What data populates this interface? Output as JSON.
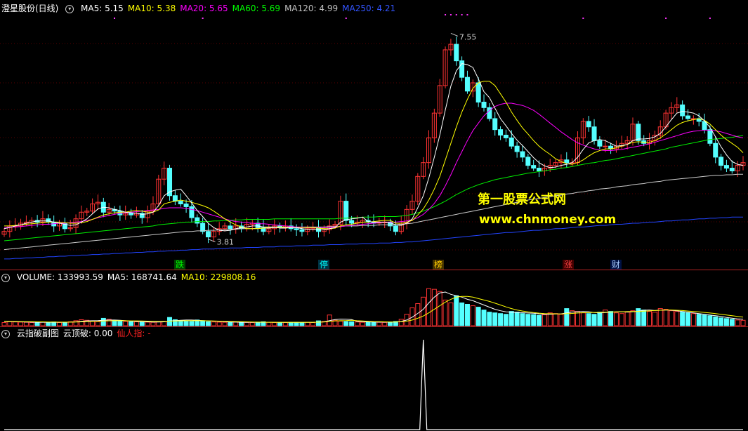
{
  "main": {
    "title": "澄星股份(日线)",
    "ma_labels": [
      {
        "text": "MA5: 5.15",
        "color": "#ffffff"
      },
      {
        "text": "MA10: 5.38",
        "color": "#ffff00"
      },
      {
        "text": "MA20: 5.65",
        "color": "#ff00ff"
      },
      {
        "text": "MA60: 5.69",
        "color": "#00ff00"
      },
      {
        "text": "MA120: 4.99",
        "color": "#c0c0c0"
      },
      {
        "text": "MA250: 4.21",
        "color": "#3355ff"
      }
    ],
    "high_label": "7.55",
    "low_label": "3.81",
    "events": [
      {
        "text": "跌",
        "color": "#00ff00",
        "bg": "#004400"
      },
      {
        "text": "停",
        "color": "#00ffff",
        "bg": "#003344"
      },
      {
        "text": "榜",
        "color": "#ffcc00",
        "bg": "#443300"
      },
      {
        "text": "涨",
        "color": "#ff4444",
        "bg": "#440000"
      },
      {
        "text": "财",
        "color": "#aaccff",
        "bg": "#001144"
      }
    ],
    "watermark_cn": "第一股票公式网",
    "watermark_url": "www.chnmoney.com"
  },
  "volume": {
    "labels": [
      {
        "text": "VOLUME: 133993.59",
        "color": "#ffffff"
      },
      {
        "text": "MA5: 168741.64",
        "color": "#ffffff"
      },
      {
        "text": "MA10: 229808.16",
        "color": "#ffff00"
      }
    ]
  },
  "indicator": {
    "labels": [
      {
        "text": "云指破副图",
        "color": "#ffffff"
      },
      {
        "text": "云顶破: 0.00",
        "color": "#ffffff"
      },
      {
        "text": "仙人指: -",
        "color": "#ff2222"
      }
    ]
  },
  "chart_data": {
    "type": "candlestick",
    "y_range": [
      3.5,
      7.9
    ],
    "close": [
      3.95,
      4.05,
      4.05,
      4.1,
      4.12,
      4.15,
      4.12,
      4.18,
      4.12,
      4.05,
      4.1,
      4.0,
      4.02,
      4.18,
      4.3,
      4.32,
      4.45,
      4.48,
      4.3,
      4.35,
      4.32,
      4.25,
      4.28,
      4.25,
      4.28,
      4.2,
      4.32,
      4.45,
      4.9,
      5.1,
      4.6,
      4.5,
      4.45,
      4.4,
      4.2,
      4.1,
      3.95,
      3.85,
      3.95,
      4.0,
      4.05,
      4.0,
      4.05,
      4.0,
      4.08,
      4.1,
      4.02,
      3.95,
      4.0,
      4.05,
      4.02,
      4.05,
      4.0,
      3.98,
      3.95,
      4.0,
      4.02,
      3.95,
      3.98,
      4.05,
      4.08,
      4.5,
      4.15,
      4.1,
      4.12,
      4.15,
      4.12,
      4.1,
      4.12,
      4.12,
      4.05,
      3.95,
      4.1,
      4.35,
      4.5,
      4.95,
      5.2,
      5.65,
      6.1,
      6.6,
      7.25,
      7.35,
      7.05,
      6.75,
      6.5,
      6.65,
      6.3,
      6.2,
      6.0,
      5.8,
      5.7,
      5.65,
      5.5,
      5.4,
      5.3,
      5.15,
      5.1,
      5.05,
      5.1,
      5.15,
      5.2,
      5.25,
      5.2,
      5.2,
      5.65,
      5.95,
      5.85,
      5.6,
      5.5,
      5.5,
      5.45,
      5.5,
      5.55,
      5.6,
      5.9,
      5.6,
      5.55,
      5.6,
      5.7,
      5.85,
      6.1,
      6.2,
      6.25,
      6.05,
      6.0,
      6.0,
      5.95,
      5.8,
      5.55,
      5.3,
      5.15,
      5.1,
      5.05,
      5.15,
      5.2
    ],
    "ma5": [
      4.0,
      4.02,
      4.05,
      4.07,
      4.1,
      4.12,
      4.14,
      4.14,
      4.14,
      4.12,
      4.1,
      4.08,
      4.06,
      4.07,
      4.12,
      4.18,
      4.27,
      4.36,
      4.39,
      4.38,
      4.35,
      4.33,
      4.3,
      4.29,
      4.28,
      4.26,
      4.27,
      4.3,
      4.42,
      4.6,
      4.67,
      4.7,
      4.72,
      4.6,
      4.47,
      4.33,
      4.22,
      4.1,
      4.02,
      3.97,
      3.96,
      3.97,
      4.0,
      4.02,
      4.03,
      4.05,
      4.05,
      4.03,
      4.03,
      4.03,
      4.01,
      4.01,
      4.02,
      4.02,
      4.0,
      3.99,
      3.99,
      3.98,
      3.98,
      4.0,
      4.02,
      4.12,
      4.16,
      4.18,
      4.19,
      4.21,
      4.13,
      4.12,
      4.12,
      4.12,
      4.11,
      4.07,
      4.06,
      4.1,
      4.18,
      4.38,
      4.6,
      4.92,
      5.3,
      5.7,
      6.16,
      6.59,
      6.87,
      7.0,
      6.98,
      6.93,
      6.72,
      6.49,
      6.38,
      6.19,
      6.0,
      5.87,
      5.73,
      5.61,
      5.51,
      5.4,
      5.29,
      5.2,
      5.14,
      5.11,
      5.12,
      5.15,
      5.17,
      5.2,
      5.3,
      5.44,
      5.56,
      5.6,
      5.62,
      5.6,
      5.55,
      5.5,
      5.51,
      5.53,
      5.6,
      5.63,
      5.63,
      5.64,
      5.67,
      5.73,
      5.85,
      5.98,
      6.1,
      6.13,
      6.12,
      6.1,
      6.05,
      5.96,
      5.84,
      5.67,
      5.49,
      5.34,
      5.22,
      5.17,
      5.15
    ],
    "ma10": [
      4.05,
      4.05,
      4.06,
      4.07,
      4.08,
      4.09,
      4.1,
      4.11,
      4.12,
      4.12,
      4.12,
      4.11,
      4.1,
      4.1,
      4.11,
      4.13,
      4.17,
      4.21,
      4.25,
      4.27,
      4.29,
      4.3,
      4.3,
      4.32,
      4.33,
      4.32,
      4.3,
      4.3,
      4.34,
      4.45,
      4.48,
      4.5,
      4.52,
      4.5,
      4.48,
      4.45,
      4.42,
      4.38,
      4.32,
      4.25,
      4.18,
      4.12,
      4.07,
      4.03,
      4.0,
      4.0,
      4.0,
      4.01,
      4.02,
      4.03,
      4.03,
      4.03,
      4.02,
      4.02,
      4.02,
      4.02,
      4.02,
      4.01,
      4.0,
      4.0,
      4.01,
      4.05,
      4.07,
      4.08,
      4.1,
      4.12,
      4.12,
      4.13,
      4.14,
      4.15,
      4.15,
      4.1,
      4.1,
      4.12,
      4.15,
      4.25,
      4.36,
      4.52,
      4.72,
      4.95,
      5.25,
      5.55,
      5.85,
      6.12,
      6.35,
      6.55,
      6.65,
      6.68,
      6.68,
      6.6,
      6.45,
      6.3,
      6.12,
      5.97,
      5.83,
      5.72,
      5.6,
      5.5,
      5.42,
      5.35,
      5.27,
      5.22,
      5.18,
      5.17,
      5.2,
      5.25,
      5.32,
      5.38,
      5.42,
      5.45,
      5.45,
      5.47,
      5.5,
      5.53,
      5.57,
      5.58,
      5.57,
      5.57,
      5.6,
      5.65,
      5.72,
      5.8,
      5.88,
      5.93,
      5.96,
      5.98,
      6.0,
      5.97,
      5.9,
      5.8,
      5.7,
      5.62,
      5.55,
      5.48,
      5.38
    ],
    "ma20": [
      4.02,
      4.03,
      4.03,
      4.04,
      4.05,
      4.06,
      4.07,
      4.08,
      4.08,
      4.09,
      4.1,
      4.1,
      4.11,
      4.12,
      4.13,
      4.15,
      4.17,
      4.2,
      4.22,
      4.24,
      4.26,
      4.28,
      4.29,
      4.3,
      4.31,
      4.32,
      4.33,
      4.34,
      4.35,
      4.37,
      4.38,
      4.38,
      4.38,
      4.37,
      4.35,
      4.33,
      4.3,
      4.27,
      4.24,
      4.21,
      4.18,
      4.15,
      4.13,
      4.12,
      4.11,
      4.1,
      4.09,
      4.09,
      4.08,
      4.07,
      4.06,
      4.05,
      4.04,
      4.03,
      4.03,
      4.02,
      4.02,
      4.02,
      4.02,
      4.02,
      4.03,
      4.04,
      4.05,
      4.06,
      4.07,
      4.08,
      4.09,
      4.1,
      4.11,
      4.12,
      4.12,
      4.12,
      4.13,
      4.14,
      4.16,
      4.2,
      4.26,
      4.35,
      4.46,
      4.6,
      4.78,
      4.98,
      5.2,
      5.4,
      5.6,
      5.78,
      5.92,
      6.05,
      6.15,
      6.22,
      6.26,
      6.28,
      6.28,
      6.26,
      6.24,
      6.2,
      6.15,
      6.08,
      6.0,
      5.92,
      5.84,
      5.76,
      5.69,
      5.62,
      5.56,
      5.52,
      5.48,
      5.45,
      5.43,
      5.42,
      5.42,
      5.43,
      5.44,
      5.46,
      5.48,
      5.5,
      5.52,
      5.54,
      5.57,
      5.6,
      5.63,
      5.66,
      5.69,
      5.72,
      5.75,
      5.77,
      5.78,
      5.79,
      5.79,
      5.78,
      5.76,
      5.73,
      5.7,
      5.67,
      5.65
    ],
    "ma60": [
      3.78,
      3.79,
      3.8,
      3.81,
      3.82,
      3.83,
      3.84,
      3.85,
      3.86,
      3.87,
      3.88,
      3.89,
      3.9,
      3.91,
      3.92,
      3.93,
      3.94,
      3.95,
      3.96,
      3.97,
      3.98,
      3.99,
      4.0,
      4.01,
      4.02,
      4.03,
      4.04,
      4.05,
      4.07,
      4.08,
      4.09,
      4.1,
      4.11,
      4.12,
      4.12,
      4.13,
      4.13,
      4.13,
      4.14,
      4.14,
      4.15,
      4.15,
      4.16,
      4.16,
      4.17,
      4.17,
      4.17,
      4.17,
      4.17,
      4.18,
      4.18,
      4.18,
      4.18,
      4.18,
      4.18,
      4.18,
      4.18,
      4.18,
      4.18,
      4.18,
      4.18,
      4.19,
      4.19,
      4.2,
      4.2,
      4.21,
      4.21,
      4.21,
      4.22,
      4.22,
      4.22,
      4.22,
      4.23,
      4.24,
      4.26,
      4.29,
      4.32,
      4.36,
      4.4,
      4.45,
      4.5,
      4.56,
      4.62,
      4.67,
      4.72,
      4.76,
      4.8,
      4.83,
      4.86,
      4.89,
      4.91,
      4.93,
      4.95,
      4.97,
      4.99,
      5.01,
      5.02,
      5.04,
      5.05,
      5.07,
      5.08,
      5.1,
      5.11,
      5.13,
      5.15,
      5.17,
      5.19,
      5.2,
      5.22,
      5.24,
      5.25,
      5.27,
      5.29,
      5.31,
      5.33,
      5.35,
      5.37,
      5.39,
      5.41,
      5.43,
      5.45,
      5.48,
      5.5,
      5.52,
      5.54,
      5.56,
      5.58,
      5.6,
      5.62,
      5.63,
      5.64,
      5.65,
      5.66,
      5.68,
      5.69
    ],
    "ma120": [
      3.62,
      3.63,
      3.64,
      3.65,
      3.66,
      3.67,
      3.68,
      3.69,
      3.7,
      3.71,
      3.72,
      3.73,
      3.74,
      3.75,
      3.76,
      3.77,
      3.78,
      3.79,
      3.8,
      3.81,
      3.82,
      3.83,
      3.84,
      3.85,
      3.86,
      3.87,
      3.88,
      3.89,
      3.9,
      3.91,
      3.92,
      3.93,
      3.94,
      3.95,
      3.95,
      3.96,
      3.96,
      3.97,
      3.97,
      3.98,
      3.98,
      3.99,
      3.99,
      4.0,
      4.0,
      4.0,
      4.01,
      4.01,
      4.01,
      4.02,
      4.02,
      4.02,
      4.02,
      4.02,
      4.03,
      4.03,
      4.03,
      4.03,
      4.03,
      4.04,
      4.04,
      4.04,
      4.05,
      4.05,
      4.05,
      4.06,
      4.06,
      4.06,
      4.07,
      4.07,
      4.07,
      4.07,
      4.08,
      4.09,
      4.1,
      4.12,
      4.14,
      4.16,
      4.18,
      4.2,
      4.22,
      4.24,
      4.26,
      4.28,
      4.3,
      4.32,
      4.34,
      4.36,
      4.38,
      4.4,
      4.42,
      4.44,
      4.46,
      4.48,
      4.5,
      4.52,
      4.54,
      4.55,
      4.57,
      4.58,
      4.6,
      4.61,
      4.63,
      4.64,
      4.66,
      4.67,
      4.69,
      4.7,
      4.72,
      4.73,
      4.74,
      4.76,
      4.77,
      4.78,
      4.8,
      4.81,
      4.82,
      4.84,
      4.85,
      4.86,
      4.88,
      4.89,
      4.9,
      4.91,
      4.92,
      4.93,
      4.94,
      4.95,
      4.96,
      4.97,
      4.97,
      4.98,
      4.98,
      4.99,
      4.99
    ],
    "ma250": [
      3.45,
      3.45,
      3.46,
      3.46,
      3.47,
      3.47,
      3.48,
      3.48,
      3.49,
      3.49,
      3.5,
      3.5,
      3.51,
      3.51,
      3.52,
      3.52,
      3.53,
      3.53,
      3.54,
      3.54,
      3.55,
      3.55,
      3.56,
      3.56,
      3.57,
      3.57,
      3.58,
      3.58,
      3.59,
      3.59,
      3.6,
      3.6,
      3.61,
      3.61,
      3.62,
      3.62,
      3.63,
      3.63,
      3.63,
      3.64,
      3.64,
      3.65,
      3.65,
      3.65,
      3.66,
      3.66,
      3.66,
      3.67,
      3.67,
      3.67,
      3.68,
      3.68,
      3.68,
      3.69,
      3.69,
      3.69,
      3.7,
      3.7,
      3.7,
      3.71,
      3.71,
      3.71,
      3.72,
      3.72,
      3.72,
      3.73,
      3.73,
      3.73,
      3.74,
      3.74,
      3.74,
      3.75,
      3.75,
      3.76,
      3.76,
      3.77,
      3.78,
      3.79,
      3.8,
      3.81,
      3.82,
      3.83,
      3.84,
      3.85,
      3.86,
      3.87,
      3.88,
      3.89,
      3.9,
      3.91,
      3.92,
      3.93,
      3.93,
      3.94,
      3.95,
      3.96,
      3.97,
      3.97,
      3.98,
      3.99,
      4.0,
      4.0,
      4.01,
      4.02,
      4.03,
      4.03,
      4.04,
      4.05,
      4.06,
      4.06,
      4.07,
      4.08,
      4.08,
      4.09,
      4.1,
      4.1,
      4.11,
      4.12,
      4.12,
      4.13,
      4.14,
      4.14,
      4.15,
      4.16,
      4.16,
      4.17,
      4.18,
      4.18,
      4.19,
      4.19,
      4.2,
      4.2,
      4.21,
      4.21,
      4.21
    ],
    "volume_range": [
      0,
      300
    ],
    "volume": [
      22,
      28,
      26,
      25,
      24,
      22,
      24,
      25,
      23,
      26,
      22,
      24,
      28,
      35,
      42,
      38,
      30,
      28,
      52,
      45,
      38,
      32,
      30,
      28,
      27,
      26,
      25,
      24,
      28,
      30,
      58,
      42,
      36,
      32,
      30,
      40,
      35,
      28,
      26,
      25,
      24,
      22,
      26,
      24,
      23,
      22,
      25,
      28,
      24,
      22,
      21,
      22,
      23,
      24,
      22,
      24,
      22,
      34,
      30,
      75,
      38,
      32,
      30,
      28,
      26,
      24,
      25,
      26,
      24,
      23,
      26,
      30,
      45,
      80,
      125,
      155,
      200,
      260,
      255,
      240,
      180,
      160,
      210,
      160,
      150,
      140,
      130,
      110,
      95,
      90,
      85,
      80,
      100,
      95,
      85,
      80,
      78,
      72,
      76,
      90,
      85,
      80,
      120,
      105,
      100,
      90,
      85,
      80,
      95,
      110,
      100,
      90,
      85,
      95,
      105,
      120,
      110,
      100,
      95,
      120,
      115,
      105,
      100,
      95,
      90,
      85,
      80,
      75,
      70,
      62,
      55,
      50,
      45,
      40,
      38
    ],
    "volume_ma5": [
      30,
      29,
      28,
      27,
      26,
      25,
      24,
      24,
      24,
      24,
      24,
      24,
      25,
      27,
      31,
      34,
      35,
      36,
      38,
      40,
      40,
      38,
      35,
      32,
      30,
      28,
      27,
      26,
      26,
      27,
      33,
      36,
      38,
      40,
      40,
      38,
      36,
      34,
      32,
      30,
      28,
      26,
      25,
      24,
      24,
      24,
      24,
      24,
      24,
      24,
      23,
      23,
      23,
      23,
      23,
      23,
      23,
      25,
      27,
      36,
      43,
      46,
      45,
      43,
      30,
      28,
      27,
      26,
      25,
      25,
      25,
      26,
      30,
      40,
      60,
      86,
      115,
      160,
      200,
      230,
      236,
      220,
      210,
      200,
      185,
      175,
      160,
      145,
      130,
      115,
      105,
      97,
      95,
      93,
      91,
      89,
      87,
      83,
      80,
      80,
      82,
      83,
      90,
      96,
      98,
      100,
      98,
      92,
      90,
      92,
      95,
      97,
      98,
      96,
      98,
      102,
      108,
      110,
      106,
      108,
      110,
      108,
      105,
      100,
      95,
      90,
      85,
      80,
      75,
      70,
      65,
      58,
      53,
      48,
      45
    ],
    "volume_ma10": [
      32,
      31,
      30,
      29,
      28,
      28,
      27,
      27,
      26,
      26,
      25,
      25,
      25,
      26,
      27,
      29,
      30,
      31,
      33,
      34,
      35,
      35,
      35,
      34,
      34,
      33,
      32,
      31,
      30,
      30,
      32,
      33,
      34,
      35,
      35,
      35,
      35,
      34,
      33,
      32,
      31,
      30,
      29,
      28,
      27,
      26,
      25,
      25,
      24,
      24,
      24,
      24,
      24,
      24,
      24,
      24,
      24,
      25,
      26,
      30,
      33,
      35,
      36,
      38,
      35,
      33,
      31,
      29,
      28,
      27,
      26,
      26,
      28,
      32,
      40,
      52,
      68,
      90,
      115,
      140,
      165,
      185,
      200,
      205,
      205,
      200,
      190,
      180,
      170,
      158,
      145,
      132,
      120,
      110,
      103,
      97,
      92,
      88,
      85,
      84,
      83,
      82,
      84,
      86,
      89,
      91,
      92,
      93,
      93,
      95,
      96,
      97,
      98,
      99,
      100,
      100,
      102,
      104,
      106,
      108,
      110,
      110,
      108,
      106,
      103,
      100,
      97,
      93,
      89,
      85,
      80,
      75,
      70,
      65,
      60
    ],
    "indicator_values_note": "single spike near the peak date",
    "indicator": [
      0,
      0,
      0,
      0,
      0,
      0,
      0,
      0,
      0,
      0,
      0,
      0,
      0,
      0,
      0,
      0,
      0,
      0,
      0,
      0,
      0,
      0,
      0,
      0,
      0,
      0,
      0,
      0,
      0,
      0,
      0,
      0,
      0,
      0,
      0,
      0,
      0,
      0,
      0,
      0,
      0,
      0,
      0,
      0,
      0,
      0,
      0,
      0,
      0,
      0,
      0,
      0,
      0,
      0,
      0,
      0,
      0,
      0,
      0,
      0,
      0,
      0,
      0,
      0,
      0,
      0,
      0,
      0,
      0,
      0,
      0,
      0,
      0,
      0,
      0,
      0,
      1,
      0,
      0,
      0,
      0,
      0,
      0,
      0,
      0,
      0,
      0,
      0,
      0,
      0,
      0,
      0,
      0,
      0,
      0,
      0,
      0,
      0,
      0,
      0,
      0,
      0,
      0,
      0,
      0,
      0,
      0,
      0,
      0,
      0,
      0,
      0,
      0,
      0,
      0,
      0,
      0,
      0,
      0,
      0,
      0,
      0,
      0,
      0,
      0,
      0,
      0,
      0,
      0,
      0,
      0,
      0,
      0,
      0,
      0
    ]
  }
}
